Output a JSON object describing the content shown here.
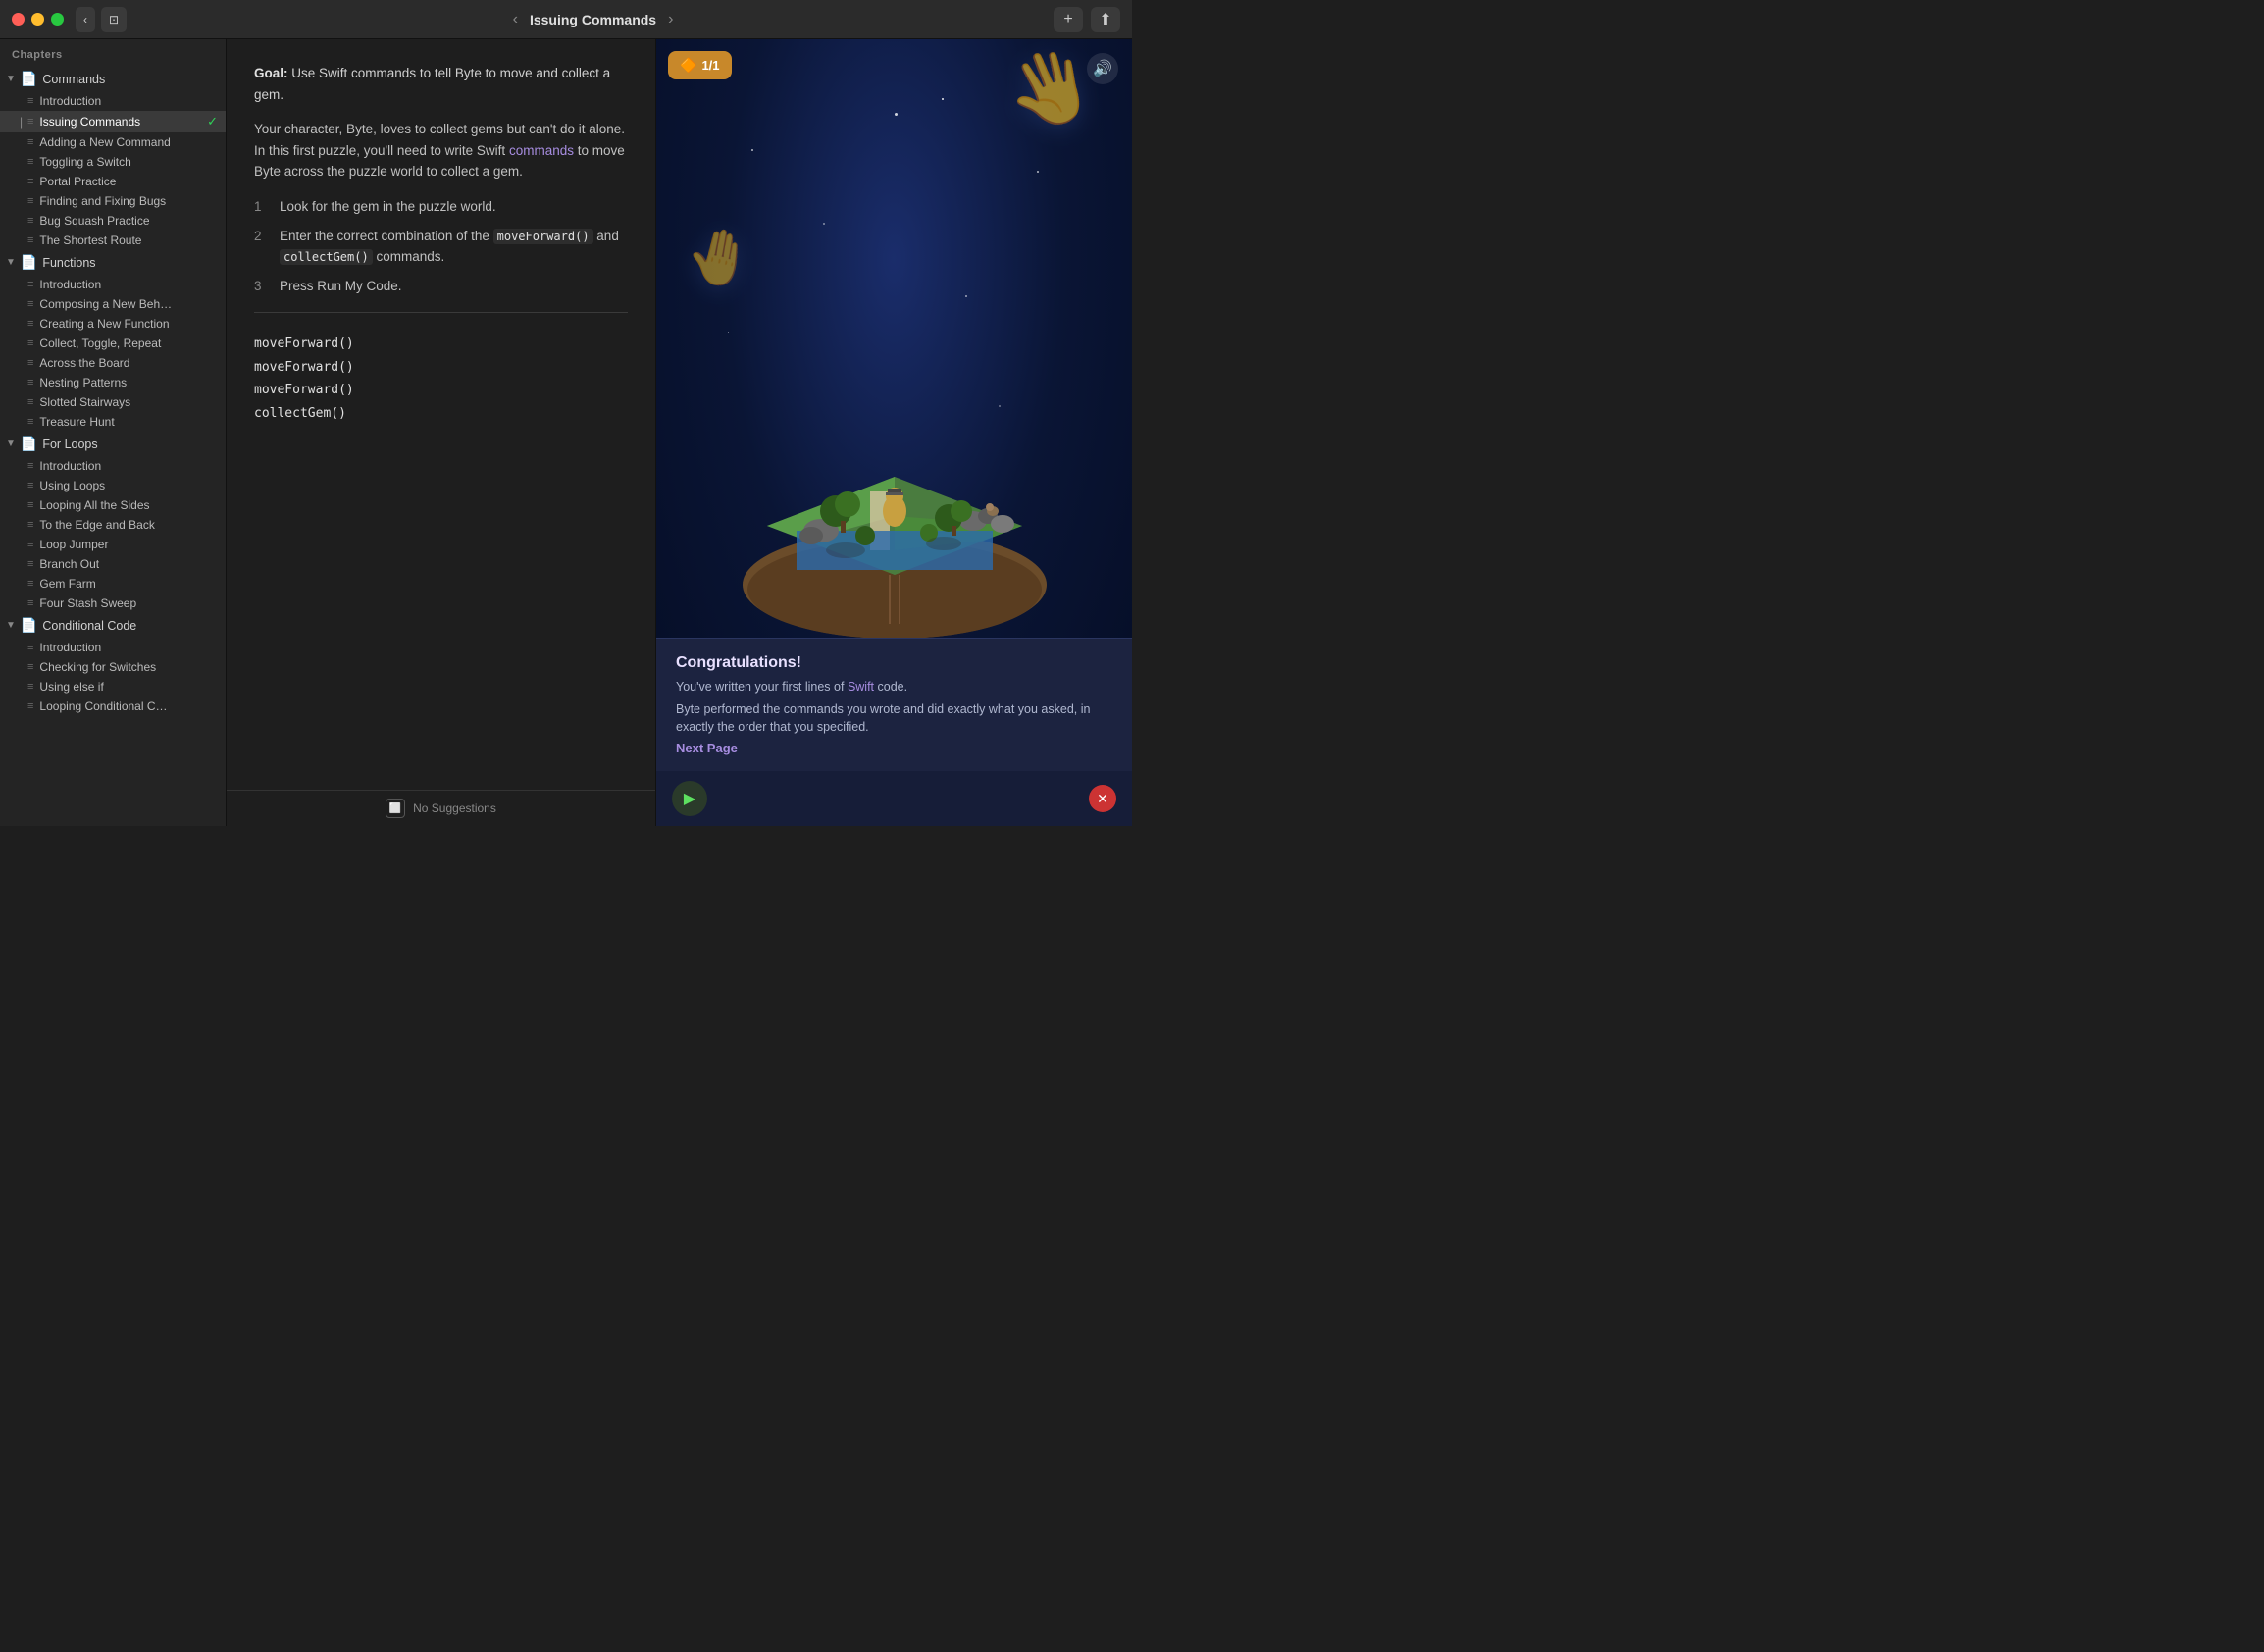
{
  "titlebar": {
    "title": "Issuing Commands",
    "back_label": "‹",
    "forward_label": "›",
    "add_label": "+",
    "share_label": "⬆"
  },
  "sidebar": {
    "chapters_label": "Chapters",
    "sections": [
      {
        "name": "Commands",
        "items": [
          {
            "label": "Introduction",
            "active": false,
            "check": false
          },
          {
            "label": "Issuing Commands",
            "active": true,
            "check": true
          },
          {
            "label": "Adding a New Command",
            "active": false,
            "check": false
          },
          {
            "label": "Toggling a Switch",
            "active": false,
            "check": false
          },
          {
            "label": "Portal Practice",
            "active": false,
            "check": false
          },
          {
            "label": "Finding and Fixing Bugs",
            "active": false,
            "check": false
          },
          {
            "label": "Bug Squash Practice",
            "active": false,
            "check": false
          },
          {
            "label": "The Shortest Route",
            "active": false,
            "check": false
          }
        ]
      },
      {
        "name": "Functions",
        "items": [
          {
            "label": "Introduction",
            "active": false,
            "check": false
          },
          {
            "label": "Composing a New Beh…",
            "active": false,
            "check": false
          },
          {
            "label": "Creating a New Function",
            "active": false,
            "check": false
          },
          {
            "label": "Collect, Toggle, Repeat",
            "active": false,
            "check": false
          },
          {
            "label": "Across the Board",
            "active": false,
            "check": false
          },
          {
            "label": "Nesting Patterns",
            "active": false,
            "check": false
          },
          {
            "label": "Slotted Stairways",
            "active": false,
            "check": false
          },
          {
            "label": "Treasure Hunt",
            "active": false,
            "check": false
          }
        ]
      },
      {
        "name": "For Loops",
        "items": [
          {
            "label": "Introduction",
            "active": false,
            "check": false
          },
          {
            "label": "Using Loops",
            "active": false,
            "check": false
          },
          {
            "label": "Looping All the Sides",
            "active": false,
            "check": false
          },
          {
            "label": "To the Edge and Back",
            "active": false,
            "check": false
          },
          {
            "label": "Loop Jumper",
            "active": false,
            "check": false
          },
          {
            "label": "Branch Out",
            "active": false,
            "check": false
          },
          {
            "label": "Gem Farm",
            "active": false,
            "check": false
          },
          {
            "label": "Four Stash Sweep",
            "active": false,
            "check": false
          }
        ]
      },
      {
        "name": "Conditional Code",
        "items": [
          {
            "label": "Introduction",
            "active": false,
            "check": false
          },
          {
            "label": "Checking for Switches",
            "active": false,
            "check": false
          },
          {
            "label": "Using else if",
            "active": false,
            "check": false
          },
          {
            "label": "Looping Conditional C…",
            "active": false,
            "check": false
          }
        ]
      }
    ]
  },
  "content": {
    "goal_label": "Goal:",
    "goal_text": "Use Swift commands to tell Byte to move and collect a gem.",
    "body1": "Your character, Byte, loves to collect gems but can't do it alone. In this first puzzle, you'll need to write Swift",
    "swift_link": "commands",
    "body1_end": "to move Byte across the puzzle world to collect a gem.",
    "steps": [
      {
        "num": "1",
        "text": "Look for the gem in the puzzle world."
      },
      {
        "num": "2",
        "text": "Enter the correct combination of the",
        "code1": "moveForward()",
        "and": "and",
        "code2": "collectGem()",
        "end": "commands."
      },
      {
        "num": "3",
        "text": "Press Run My Code."
      }
    ],
    "code_lines": [
      "moveForward()",
      "moveForward()",
      "moveForward()",
      "collectGem()"
    ],
    "suggestions_label": "No Suggestions"
  },
  "game": {
    "gem_badge": "1/1",
    "congrats_title": "Congratulations!",
    "congrats_line1": "You've written your first lines of",
    "swift_word": "Swift",
    "congrats_line1_end": "code.",
    "congrats_line2": "Byte performed the commands you wrote and did exactly what you asked, in exactly the order that you specified.",
    "next_page_label": "Next Page"
  }
}
